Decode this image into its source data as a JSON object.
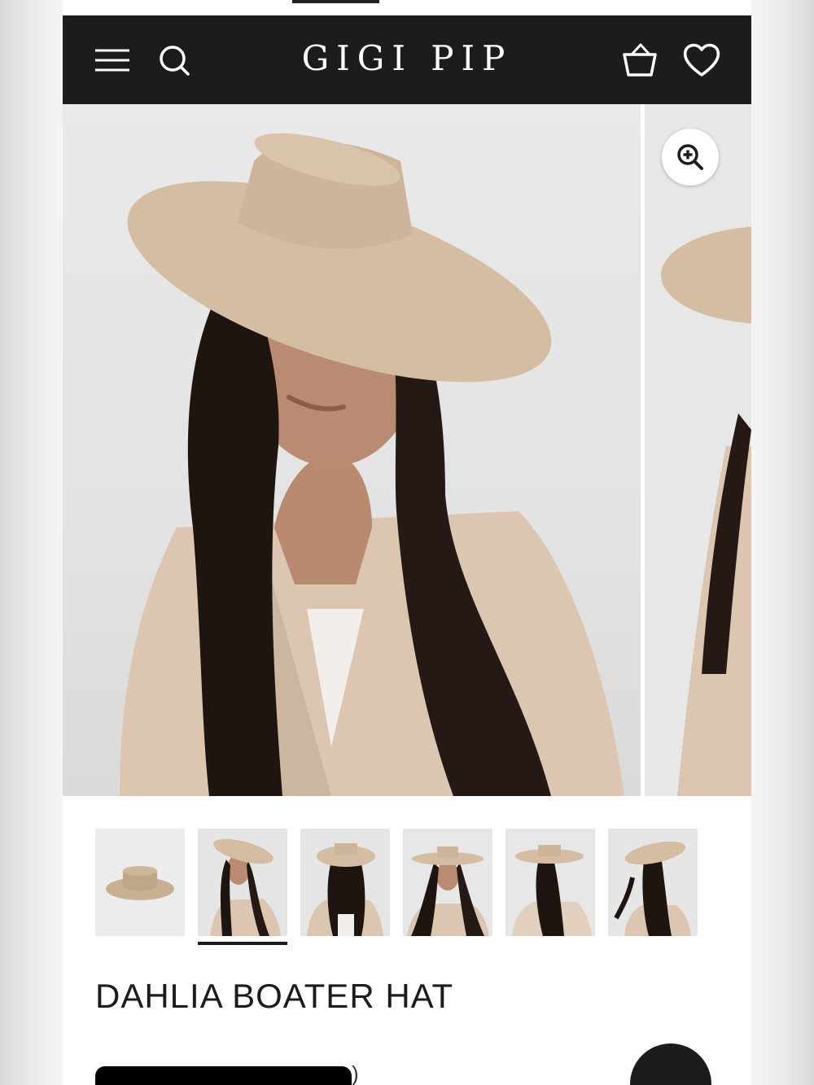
{
  "header": {
    "logo": "GIGI PIP",
    "menu_icon": "hamburger-menu-icon",
    "search_icon": "search-icon",
    "cart_icon": "basket-icon",
    "wishlist_icon": "heart-icon",
    "background": "#1c1c1c"
  },
  "gallery": {
    "zoom_icon": "zoom-in-icon",
    "active_thumbnail": 2,
    "thumbnail_count": 6
  },
  "product": {
    "title": "DAHLIA BOATER HAT",
    "rating_suffix": ")"
  },
  "colors": {
    "hat": "#d6bfa6",
    "hair": "#1f1510",
    "backdrop": "#e6e6e7"
  }
}
